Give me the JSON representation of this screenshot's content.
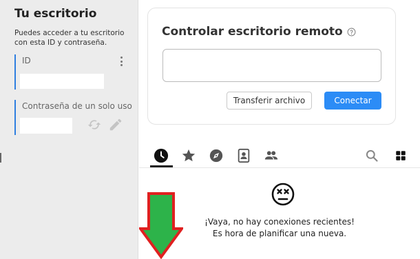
{
  "sidebar": {
    "title": "Tu escritorio",
    "description": "Puedes acceder a tu escritorio con esta ID y contraseña.",
    "id_label": "ID",
    "password_label": "Contraseña de un solo uso",
    "icons": [
      "more-vertical-icon",
      "refresh-icon",
      "pencil-icon"
    ]
  },
  "remote": {
    "title": "Controlar escritorio remoto",
    "transfer_label": "Transferir archivo",
    "connect_label": "Conectar",
    "accent": "#2c8cf6"
  },
  "tabs": {
    "items": [
      "recent-icon",
      "star-icon",
      "compass-icon",
      "address-book-icon",
      "group-icon"
    ],
    "active": "recent-icon",
    "right_icons": [
      "search-icon",
      "grid-icon"
    ]
  },
  "empty_state": {
    "icon": "dizzy-face-icon",
    "line1": "¡Vaya, no hay conexiones recientes!",
    "line2": "Es hora de planificar una nueva."
  },
  "overlay": {
    "icon": "down-arrow-icon",
    "fill": "#2db34a",
    "stroke": "#e02020"
  }
}
